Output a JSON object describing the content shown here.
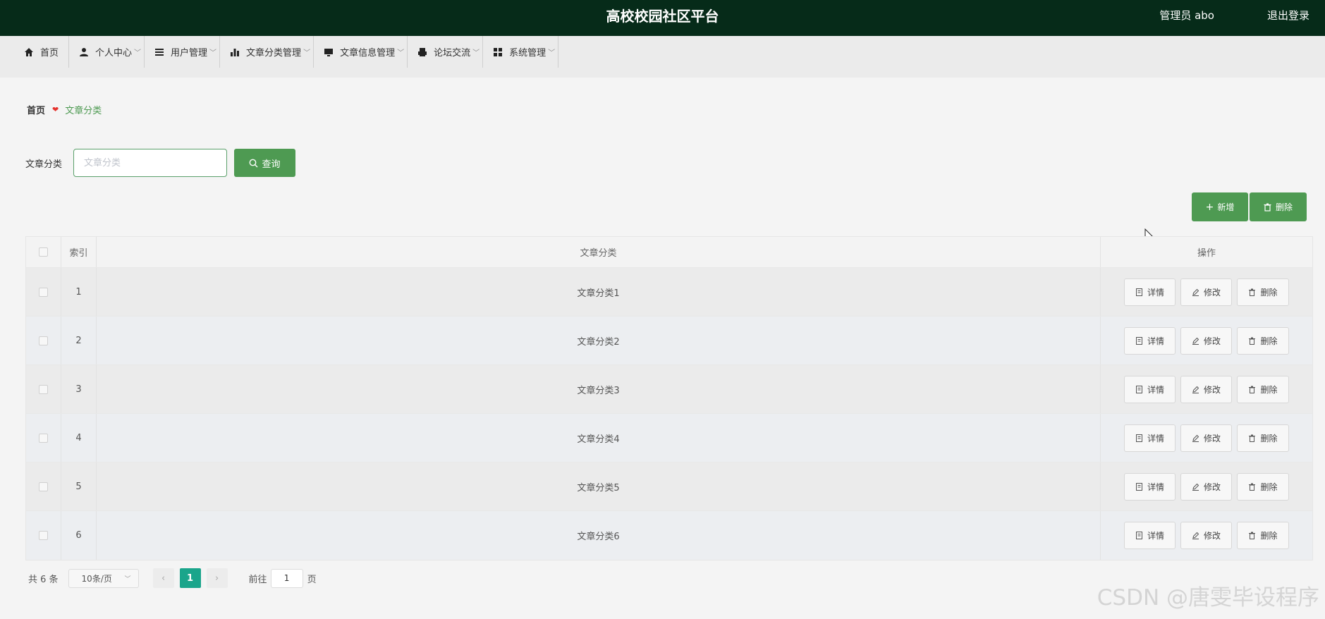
{
  "header": {
    "title": "高校校园社区平台",
    "user": "管理员 abo",
    "logout": "退出登录"
  },
  "nav": {
    "items": [
      {
        "label": "首页",
        "icon": "home-icon"
      },
      {
        "label": "个人中心",
        "icon": "user-icon"
      },
      {
        "label": "用户管理",
        "icon": "list-icon"
      },
      {
        "label": "文章分类管理",
        "icon": "bar-chart-icon"
      },
      {
        "label": "文章信息管理",
        "icon": "monitor-icon"
      },
      {
        "label": "论坛交流",
        "icon": "printer-icon"
      },
      {
        "label": "系统管理",
        "icon": "grid-icon"
      }
    ]
  },
  "breadcrumb": {
    "home": "首页",
    "current": "文章分类"
  },
  "search": {
    "label": "文章分类",
    "placeholder": "文章分类",
    "button": "查询"
  },
  "actions": {
    "add": "新增",
    "delete": "删除"
  },
  "table": {
    "headers": {
      "index": "索引",
      "name": "文章分类",
      "operation": "操作"
    },
    "rows": [
      {
        "index": "1",
        "name": "文章分类1"
      },
      {
        "index": "2",
        "name": "文章分类2"
      },
      {
        "index": "3",
        "name": "文章分类3"
      },
      {
        "index": "4",
        "name": "文章分类4"
      },
      {
        "index": "5",
        "name": "文章分类5"
      },
      {
        "index": "6",
        "name": "文章分类6"
      }
    ],
    "row_actions": {
      "detail": "详情",
      "edit": "修改",
      "delete": "删除"
    }
  },
  "pagination": {
    "total": "共 6 条",
    "page_size": "10条/页",
    "current_page": "1",
    "goto_label": "前往",
    "goto_value": "1",
    "page_suffix": "页"
  },
  "watermark": "CSDN @唐雯毕设程序",
  "colors": {
    "header_bg": "#062b19",
    "accent": "#4e9a52",
    "page_active": "#1aa58b"
  }
}
